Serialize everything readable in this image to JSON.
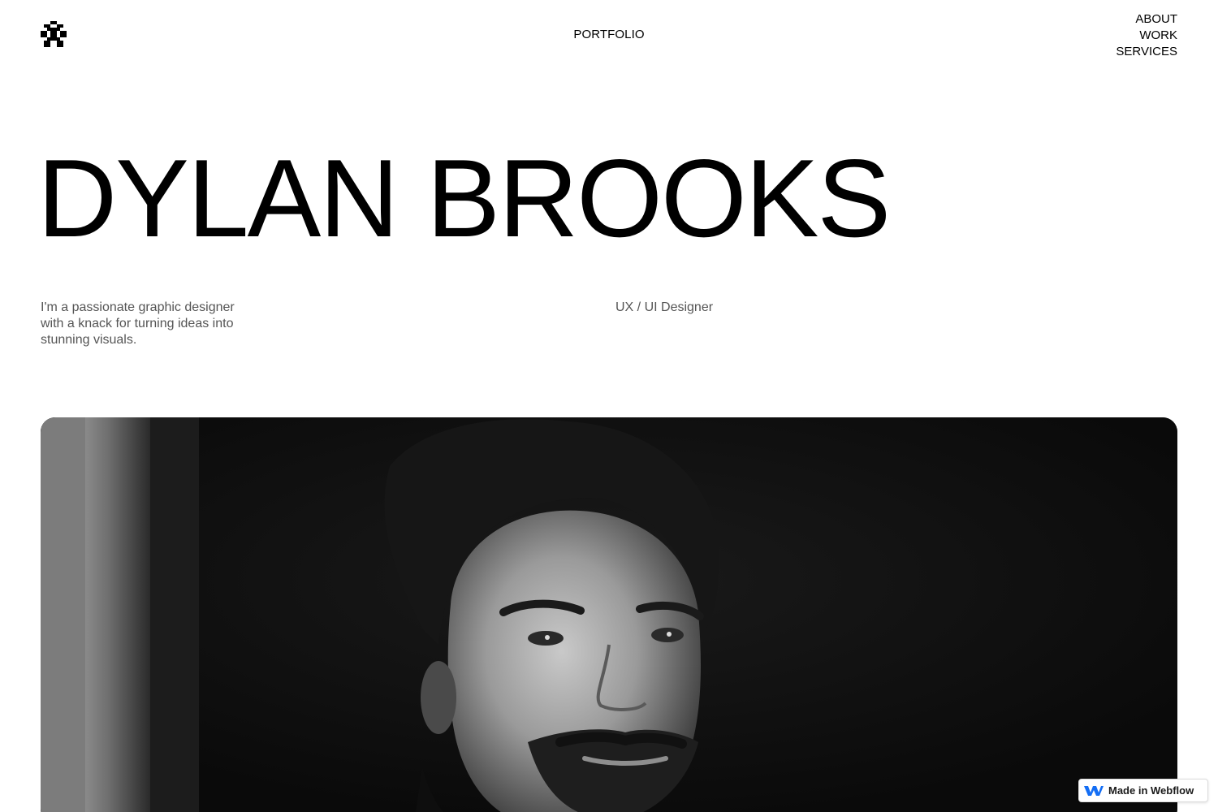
{
  "logo": {
    "icon": "pixel-creature-icon"
  },
  "header": {
    "center_link": "PORTFOLIO",
    "nav": [
      {
        "label": "ABOUT"
      },
      {
        "label": "WORK"
      },
      {
        "label": "SERVICES"
      }
    ]
  },
  "hero": {
    "title": "DYLAN BROOKS",
    "intro": "I'm a passionate graphic designer with a knack for turning ideas into stunning visuals.",
    "role": "UX / UI Designer"
  },
  "photo": {
    "style": "black-and-white portrait"
  },
  "badge": {
    "label": "Made in Webflow",
    "icon": "webflow-icon",
    "accent": "#146ef5"
  },
  "colors": {
    "text": "#000000",
    "muted": "#555555",
    "background": "#ffffff"
  }
}
